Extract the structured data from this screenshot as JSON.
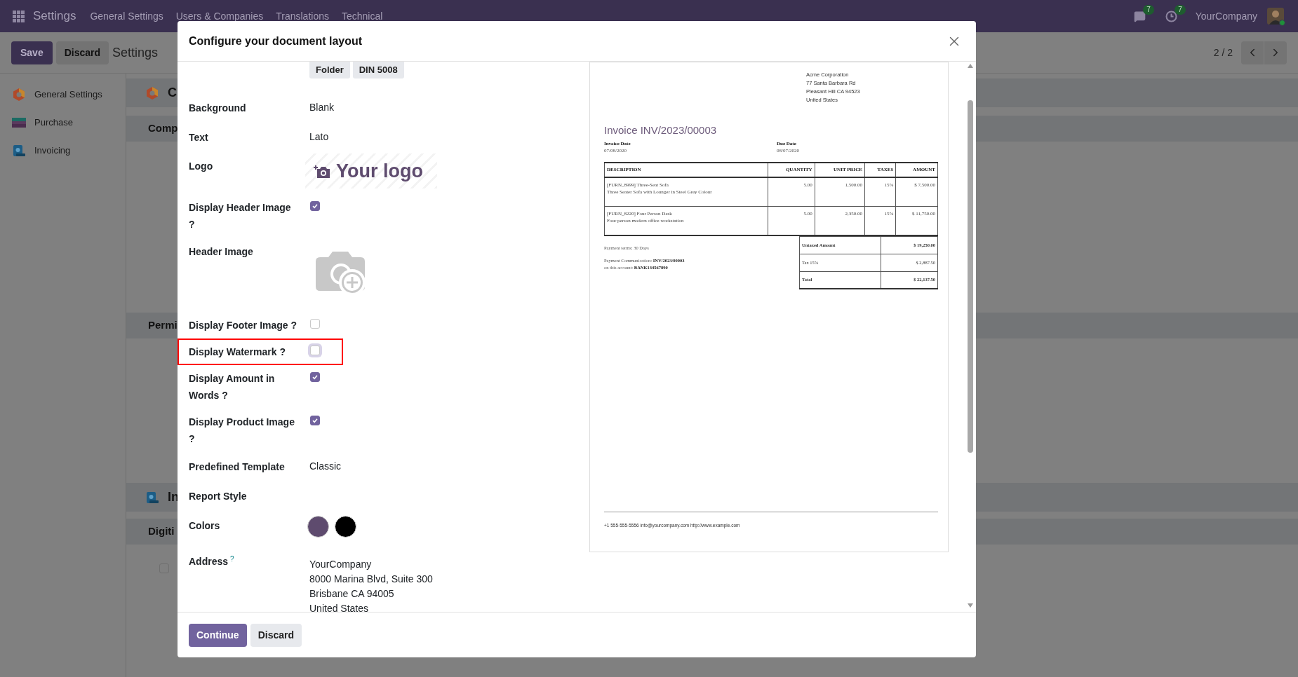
{
  "navbar": {
    "app": "Settings",
    "menu": [
      "General Settings",
      "Users & Companies",
      "Translations",
      "Technical"
    ],
    "messages_count": "7",
    "activities_count": "7",
    "company": "YourCompany"
  },
  "control_panel": {
    "save": "Save",
    "discard": "Discard",
    "title": "Settings",
    "pager": "2 / 2"
  },
  "sidebar": {
    "items": [
      {
        "label": "General Settings",
        "kind": "general",
        "selected": false
      },
      {
        "label": "Purchase",
        "kind": "purchase",
        "selected": false
      },
      {
        "label": "Invoicing",
        "kind": "invoicing",
        "selected": false
      }
    ]
  },
  "background_sections": [
    {
      "kind": "general",
      "text": "C"
    },
    {
      "kind": "header",
      "text": "Comp"
    },
    {
      "kind": "header",
      "text": "Permi"
    },
    {
      "kind": "invoicing",
      "text": "In"
    },
    {
      "kind": "header",
      "text": "Digiti"
    }
  ],
  "background_checkbox": {
    "checked": false
  },
  "modal": {
    "title": "Configure your document layout",
    "layouts": [
      "Folder",
      "DIN 5008"
    ],
    "fields": [
      {
        "kind": "text",
        "label": "Background",
        "value": "Blank"
      },
      {
        "kind": "text",
        "label": "Text",
        "value": "Lato"
      },
      {
        "kind": "logo",
        "label": "Logo",
        "logo_text": "Your logo"
      },
      {
        "kind": "checkbox",
        "label": "Display Header Image ?",
        "checked": true,
        "highlighted": false
      },
      {
        "kind": "image",
        "label": "Header Image"
      },
      {
        "kind": "checkbox",
        "label": "Display Footer Image ?",
        "checked": false,
        "highlighted": false
      },
      {
        "kind": "checkbox",
        "label": "Display Watermark ?",
        "checked": false,
        "highlighted": true
      },
      {
        "kind": "checkbox",
        "label": "Display Amount in Words ?",
        "checked": true,
        "highlighted": false
      },
      {
        "kind": "checkbox",
        "label": "Display Product Image ?",
        "checked": true,
        "highlighted": false
      },
      {
        "kind": "text",
        "label": "Predefined Template",
        "value": "Classic"
      },
      {
        "kind": "text",
        "label": "Report Style"
      },
      {
        "kind": "colors",
        "label": "Colors",
        "colors": [
          {
            "color": "#5e4b6e"
          },
          {
            "color": "#000000"
          }
        ]
      },
      {
        "kind": "address",
        "label": "Address",
        "help": "?",
        "lines": [
          "YourCompany",
          "8000 Marina Blvd, Suite 300",
          "Brisbane CA 94005",
          "United States"
        ]
      }
    ],
    "buttons": [
      "Continue",
      "Discard"
    ]
  },
  "preview": {
    "company_address": [
      "Acme Corporation",
      "77 Santa Barbara Rd",
      "Pleasant Hill CA 94523",
      "United States"
    ],
    "title": "Invoice INV/2023/00003",
    "dates": [
      {
        "label": "Invoice Date",
        "value": "07/08/2020"
      },
      {
        "label": "Due Date",
        "value": "08/07/2020"
      }
    ],
    "columns": [
      "DESCRIPTION",
      "QUANTITY",
      "UNIT PRICE",
      "TAXES",
      "AMOUNT"
    ],
    "rows": [
      {
        "name": "[FURN_8999] Three-Seat Sofa",
        "description": "Three Seater Sofa with Lounger in Steel Grey Colour",
        "quantity": "5.00",
        "unit_price": "1,500.00",
        "taxes": "15%",
        "amount": "$ 7,500.00"
      },
      {
        "name": "[FURN_8220] Four Person Desk",
        "description": "Four person modern office workstation",
        "quantity": "5.00",
        "unit_price": "2,350.00",
        "taxes": "15%",
        "amount": "$ 11,750.00"
      }
    ],
    "payment_terms": "Payment terms: 30 Days",
    "payment_communication": [
      "Payment Communication: **INV/2023/00003**",
      "on this account: **BANK134567890**"
    ],
    "totals": [
      {
        "label": "Untaxed Amount",
        "value": "$ 19,250.00",
        "bold": true
      },
      {
        "label": "Tax 15%",
        "value": "$ 2,887.50",
        "bold": false
      },
      {
        "label": "Total",
        "value": "$ 22,137.50",
        "bold": true
      }
    ],
    "footer": "+1 555-555-5556 info@yourcompany.com http://www.example.com"
  }
}
